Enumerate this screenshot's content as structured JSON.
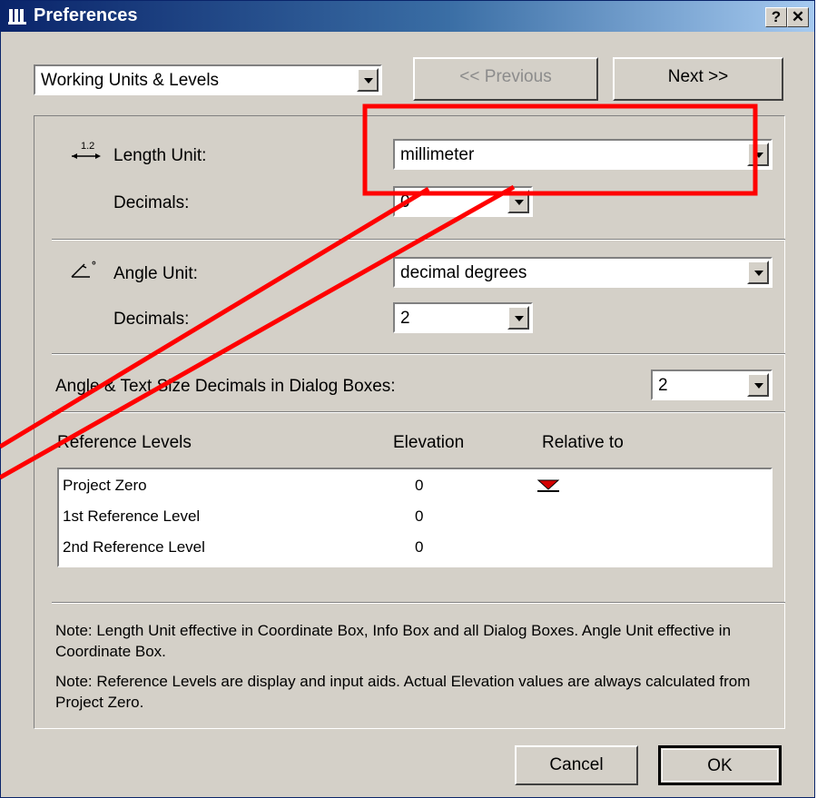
{
  "window": {
    "title": "Preferences",
    "help_btn": "?",
    "close_btn": "✕"
  },
  "nav": {
    "page_select": "Working Units & Levels",
    "prev_label": "<< Previous",
    "next_label": "Next >>"
  },
  "length": {
    "icon_text": "1.2",
    "label": "Length Unit:",
    "value": "millimeter",
    "decimals_label": "Decimals:",
    "decimals_value": "0"
  },
  "angle": {
    "icon_text": "°",
    "label": "Angle Unit:",
    "value": "decimal degrees",
    "decimals_label": "Decimals:",
    "decimals_value": "2"
  },
  "dialog_decimals": {
    "label": "Angle & Text Size Decimals in Dialog Boxes:",
    "value": "2"
  },
  "levels": {
    "headers": {
      "name": "Reference Levels",
      "elevation": "Elevation",
      "relative": "Relative to"
    },
    "rows": [
      {
        "name": "Project Zero",
        "elevation": "0"
      },
      {
        "name": "1st Reference Level",
        "elevation": "0"
      },
      {
        "name": "2nd Reference Level",
        "elevation": "0"
      }
    ]
  },
  "notes": {
    "note1": "Note: Length Unit effective in Coordinate Box, Info Box and all Dialog Boxes. Angle Unit effective in Coordinate Box.",
    "note2": "Note: Reference Levels are display and input aids. Actual Elevation values are always calculated from Project Zero."
  },
  "buttons": {
    "cancel": "Cancel",
    "ok": "OK"
  },
  "colors": {
    "annotation": "#ff0000",
    "marker": "#d40000"
  }
}
